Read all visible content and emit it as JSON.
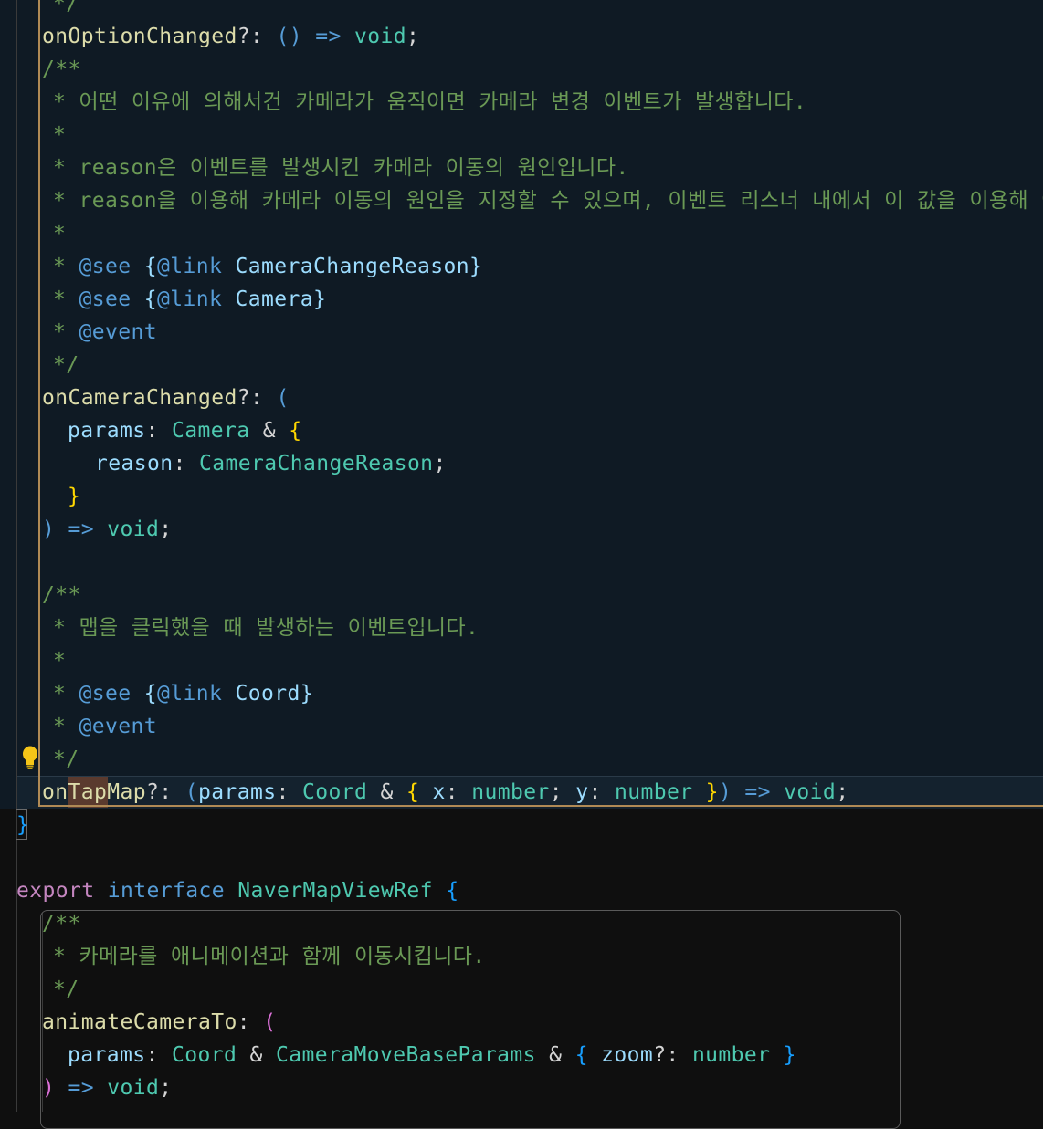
{
  "editor": {
    "lines": [
      {
        "id": "l0",
        "indent": 58,
        "tokens": [
          {
            "t": "*/",
            "c": "c-comment"
          }
        ]
      },
      {
        "id": "l1",
        "indent": 46,
        "tokens": [
          {
            "t": "onOptionChanged",
            "c": "c-yellowprop"
          },
          {
            "t": "?: ",
            "c": "c-punct"
          },
          {
            "t": "()",
            "c": "c-paren1"
          },
          {
            "t": " => ",
            "c": "c-kwb"
          },
          {
            "t": "void",
            "c": "c-type"
          },
          {
            "t": ";",
            "c": "c-punct"
          }
        ]
      },
      {
        "id": "l2",
        "indent": 46,
        "tokens": [
          {
            "t": "/**",
            "c": "c-comment"
          }
        ]
      },
      {
        "id": "l3",
        "indent": 58,
        "tokens": [
          {
            "t": "* 어떤 이유에 의해서건 카메라가 움직이면 카메라 변경 이벤트가 발생합니다.",
            "c": "c-comment"
          }
        ]
      },
      {
        "id": "l4",
        "indent": 58,
        "tokens": [
          {
            "t": "*",
            "c": "c-comment"
          }
        ]
      },
      {
        "id": "l5",
        "indent": 58,
        "tokens": [
          {
            "t": "* reason은 이벤트를 발생시킨 카메라 이동의 원인입니다.",
            "c": "c-comment"
          }
        ]
      },
      {
        "id": "l6",
        "indent": 58,
        "tokens": [
          {
            "t": "* reason을 이용해 카메라 이동의 원인을 지정할 수 있으며, 이벤트 리스너 내에서 이 값을 이용해 어떤",
            "c": "c-comment"
          }
        ]
      },
      {
        "id": "l7",
        "indent": 58,
        "tokens": [
          {
            "t": "*",
            "c": "c-comment"
          }
        ]
      },
      {
        "id": "l8",
        "indent": 58,
        "tokens": [
          {
            "t": "* ",
            "c": "c-comment"
          },
          {
            "t": "@see",
            "c": "c-tag"
          },
          {
            "t": " ",
            "c": "c-comment"
          },
          {
            "t": "{",
            "c": "c-param"
          },
          {
            "t": "@link",
            "c": "c-tag"
          },
          {
            "t": " CameraChangeReason",
            "c": "c-param"
          },
          {
            "t": "}",
            "c": "c-param"
          }
        ]
      },
      {
        "id": "l9",
        "indent": 58,
        "tokens": [
          {
            "t": "* ",
            "c": "c-comment"
          },
          {
            "t": "@see",
            "c": "c-tag"
          },
          {
            "t": " ",
            "c": "c-comment"
          },
          {
            "t": "{",
            "c": "c-param"
          },
          {
            "t": "@link",
            "c": "c-tag"
          },
          {
            "t": " Camera",
            "c": "c-param"
          },
          {
            "t": "}",
            "c": "c-param"
          }
        ]
      },
      {
        "id": "l10",
        "indent": 58,
        "tokens": [
          {
            "t": "* ",
            "c": "c-comment"
          },
          {
            "t": "@event",
            "c": "c-tag"
          }
        ]
      },
      {
        "id": "l11",
        "indent": 58,
        "tokens": [
          {
            "t": "*/",
            "c": "c-comment"
          }
        ]
      },
      {
        "id": "l12",
        "indent": 46,
        "tokens": [
          {
            "t": "onCameraChanged",
            "c": "c-yellowprop"
          },
          {
            "t": "?: ",
            "c": "c-punct"
          },
          {
            "t": "(",
            "c": "c-paren1"
          }
        ]
      },
      {
        "id": "l13",
        "indent": 74,
        "tokens": [
          {
            "t": "params",
            "c": "c-param"
          },
          {
            "t": ": ",
            "c": "c-punct"
          },
          {
            "t": "Camera",
            "c": "c-type"
          },
          {
            "t": " & ",
            "c": "c-punct"
          },
          {
            "t": "{",
            "c": "c-brace"
          }
        ]
      },
      {
        "id": "l14",
        "indent": 104,
        "tokens": [
          {
            "t": "reason",
            "c": "c-param"
          },
          {
            "t": ": ",
            "c": "c-punct"
          },
          {
            "t": "CameraChangeReason",
            "c": "c-type"
          },
          {
            "t": ";",
            "c": "c-punct"
          }
        ]
      },
      {
        "id": "l15",
        "indent": 74,
        "tokens": [
          {
            "t": "}",
            "c": "c-brace"
          }
        ]
      },
      {
        "id": "l16",
        "indent": 46,
        "tokens": [
          {
            "t": ")",
            "c": "c-paren1"
          },
          {
            "t": " => ",
            "c": "c-kwb"
          },
          {
            "t": "void",
            "c": "c-type"
          },
          {
            "t": ";",
            "c": "c-punct"
          }
        ]
      },
      {
        "id": "l17",
        "indent": 46,
        "tokens": []
      },
      {
        "id": "l18",
        "indent": 46,
        "tokens": [
          {
            "t": "/**",
            "c": "c-comment"
          }
        ]
      },
      {
        "id": "l19",
        "indent": 58,
        "tokens": [
          {
            "t": "* 맵을 클릭했을 때 발생하는 이벤트입니다.",
            "c": "c-comment"
          }
        ]
      },
      {
        "id": "l20",
        "indent": 58,
        "tokens": [
          {
            "t": "*",
            "c": "c-comment"
          }
        ]
      },
      {
        "id": "l21",
        "indent": 58,
        "tokens": [
          {
            "t": "* ",
            "c": "c-comment"
          },
          {
            "t": "@see",
            "c": "c-tag"
          },
          {
            "t": " ",
            "c": "c-comment"
          },
          {
            "t": "{",
            "c": "c-param"
          },
          {
            "t": "@link",
            "c": "c-tag"
          },
          {
            "t": " Coord",
            "c": "c-param"
          },
          {
            "t": "}",
            "c": "c-param"
          }
        ]
      },
      {
        "id": "l22",
        "indent": 58,
        "tokens": [
          {
            "t": "* ",
            "c": "c-comment"
          },
          {
            "t": "@event",
            "c": "c-tag"
          }
        ]
      },
      {
        "id": "l23",
        "indent": 58,
        "tokens": [
          {
            "t": "*/",
            "c": "c-comment"
          }
        ]
      },
      {
        "id": "l24",
        "indent": 46,
        "tokens": [
          {
            "t": "onTapMap",
            "c": "c-yellowprop"
          },
          {
            "t": "?: ",
            "c": "c-punct"
          },
          {
            "t": "(",
            "c": "c-paren1"
          },
          {
            "t": "params",
            "c": "c-param"
          },
          {
            "t": ": ",
            "c": "c-punct"
          },
          {
            "t": "Coord",
            "c": "c-type"
          },
          {
            "t": " & ",
            "c": "c-punct"
          },
          {
            "t": "{",
            "c": "c-brace"
          },
          {
            "t": " x",
            "c": "c-param"
          },
          {
            "t": ": ",
            "c": "c-punct"
          },
          {
            "t": "number",
            "c": "c-type"
          },
          {
            "t": "; ",
            "c": "c-punct"
          },
          {
            "t": "y",
            "c": "c-param"
          },
          {
            "t": ": ",
            "c": "c-punct"
          },
          {
            "t": "number",
            "c": "c-type"
          },
          {
            "t": " }",
            "c": "c-brace"
          },
          {
            "t": ")",
            "c": "c-paren1"
          },
          {
            "t": " => ",
            "c": "c-kwb"
          },
          {
            "t": "void",
            "c": "c-type"
          },
          {
            "t": ";",
            "c": "c-punct"
          }
        ]
      },
      {
        "id": "l25",
        "indent": 18,
        "tokens": [
          {
            "t": "}",
            "c": "c-brace-blue"
          }
        ]
      },
      {
        "id": "l26",
        "indent": 18,
        "tokens": []
      },
      {
        "id": "l27",
        "indent": 18,
        "tokens": [
          {
            "t": "export",
            "c": "c-kw"
          },
          {
            "t": " ",
            "c": "c-punct"
          },
          {
            "t": "interface",
            "c": "c-kwb"
          },
          {
            "t": " ",
            "c": "c-punct"
          },
          {
            "t": "NaverMapViewRef",
            "c": "c-type"
          },
          {
            "t": " ",
            "c": "c-punct"
          },
          {
            "t": "{",
            "c": "c-brace-blue"
          }
        ]
      },
      {
        "id": "l28",
        "indent": 46,
        "tokens": [
          {
            "t": "/**",
            "c": "c-comment"
          }
        ]
      },
      {
        "id": "l29",
        "indent": 58,
        "tokens": [
          {
            "t": "* 카메라를 애니메이션과 함께 이동시킵니다.",
            "c": "c-comment"
          }
        ]
      },
      {
        "id": "l30",
        "indent": 58,
        "tokens": [
          {
            "t": "*/",
            "c": "c-comment"
          }
        ]
      },
      {
        "id": "l31",
        "indent": 46,
        "tokens": [
          {
            "t": "animateCameraTo",
            "c": "c-yellowprop"
          },
          {
            "t": ": ",
            "c": "c-punct"
          },
          {
            "t": "(",
            "c": "c-paren2"
          }
        ]
      },
      {
        "id": "l32",
        "indent": 74,
        "tokens": [
          {
            "t": "params",
            "c": "c-param"
          },
          {
            "t": ": ",
            "c": "c-punct"
          },
          {
            "t": "Coord",
            "c": "c-type"
          },
          {
            "t": " & ",
            "c": "c-punct"
          },
          {
            "t": "CameraMoveBaseParams",
            "c": "c-type"
          },
          {
            "t": " & ",
            "c": "c-punct"
          },
          {
            "t": "{",
            "c": "c-brace-blue"
          },
          {
            "t": " zoom",
            "c": "c-param"
          },
          {
            "t": "?: ",
            "c": "c-punct"
          },
          {
            "t": "number",
            "c": "c-type"
          },
          {
            "t": " }",
            "c": "c-brace-blue"
          }
        ]
      },
      {
        "id": "l33",
        "indent": 46,
        "tokens": [
          {
            "t": ")",
            "c": "c-paren2"
          },
          {
            "t": " => ",
            "c": "c-kwb"
          },
          {
            "t": "void",
            "c": "c-type"
          },
          {
            "t": ";",
            "c": "c-punct"
          }
        ]
      }
    ]
  },
  "gutter": {
    "lightbulb_icon": "lightbulb-icon"
  }
}
